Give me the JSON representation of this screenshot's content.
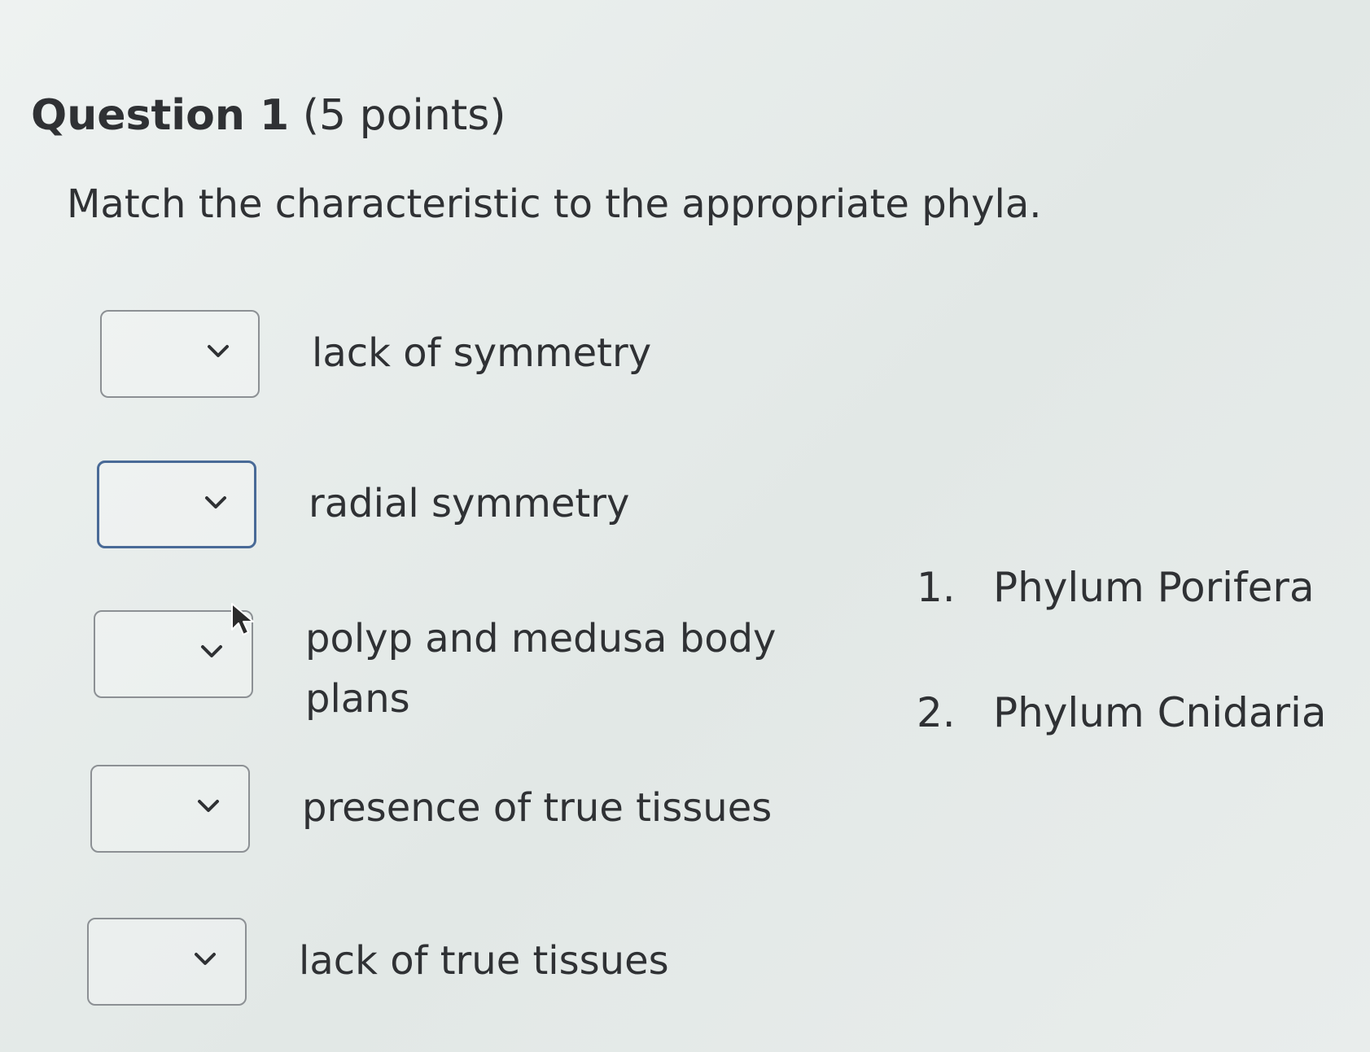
{
  "question": {
    "title": "Question 1",
    "points": "(5 points)",
    "prompt": "Match the characteristic to the appropriate phyla."
  },
  "match_rows": [
    {
      "label": "lack of symmetry",
      "selected_value": ""
    },
    {
      "label": "radial symmetry",
      "selected_value": ""
    },
    {
      "label": "polyp and medusa body plans",
      "selected_value": ""
    },
    {
      "label": "presence of true tissues",
      "selected_value": ""
    },
    {
      "label": "lack of true tissues",
      "selected_value": ""
    }
  ],
  "options": [
    {
      "number": "1.",
      "label": "Phylum Porifera"
    },
    {
      "number": "2.",
      "label": "Phylum Cnidaria"
    }
  ],
  "icons": {
    "dropdown": "chevron-down-icon",
    "pointer": "mouse-cursor-icon"
  },
  "colors": {
    "text": "#2f3134",
    "box_border": "#8c9094",
    "focus_border": "#496a97"
  }
}
